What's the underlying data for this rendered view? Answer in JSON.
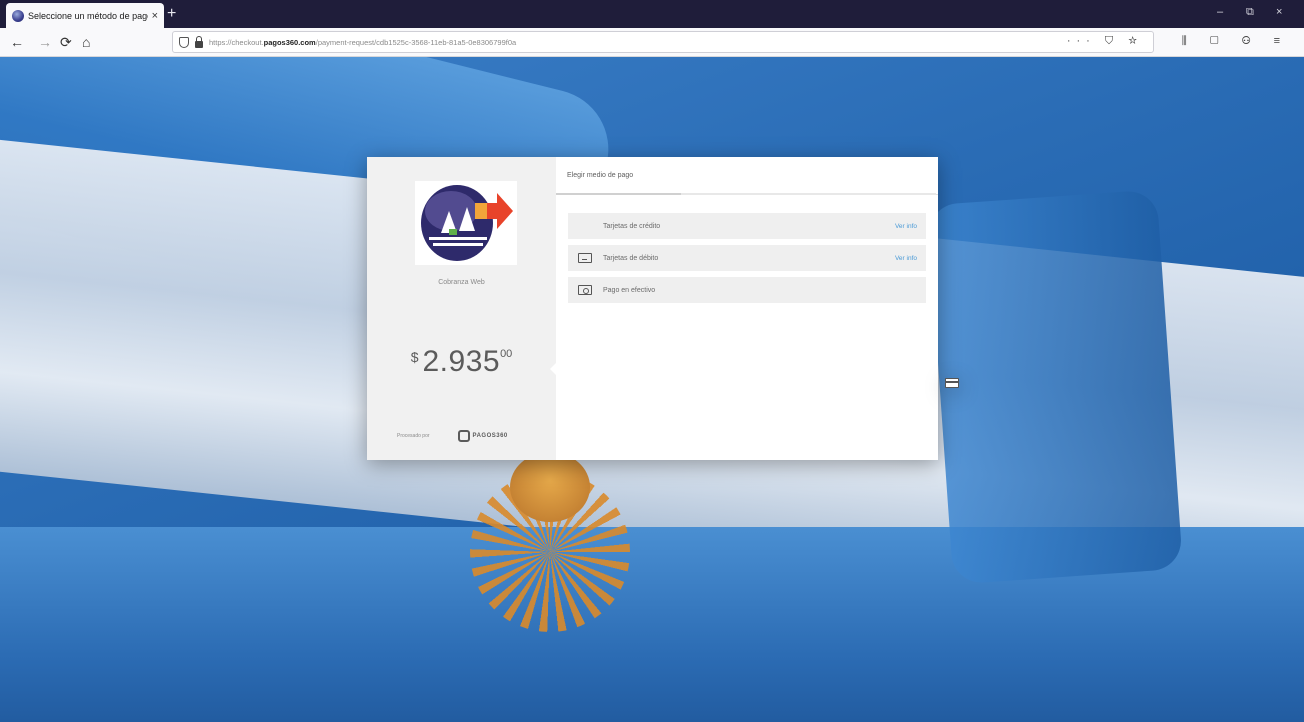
{
  "browser": {
    "tab_title": "Seleccione un método de pago",
    "tab_close": "×",
    "new_tab": "+",
    "url_prefix": "https://checkout.",
    "url_domain": "pagos360.com",
    "url_path": "/payment-request/cdb1525c-3568-11eb-81a5-0e8306799f0a",
    "window_controls": {
      "minimize": "–",
      "maximize": "⧉",
      "close": "×"
    },
    "nav": {
      "back": "←",
      "forward": "→",
      "reload": "⟳",
      "home": "⌂"
    },
    "url_actions": "··· ⛉ ☆",
    "toolbar_icons": "⫼ ▢ ⚇ ≡"
  },
  "payment": {
    "merchant_name": "Cobranza Web",
    "currency_symbol": "$",
    "amount_integer": "2.935",
    "amount_cents": "00",
    "powered_by": "Procesado por",
    "processor_name": "PAGOS360",
    "tab_label": "Elegir medio de pago",
    "methods": [
      {
        "label": "Tarjetas de crédito",
        "info": "Ver info",
        "icon": "credit-card-icon"
      },
      {
        "label": "Tarjetas de débito",
        "info": "Ver info",
        "icon": "debit-card-icon"
      },
      {
        "label": "Pago en efectivo",
        "info": "",
        "icon": "cash-icon"
      }
    ]
  },
  "colors": {
    "link": "#4a9ad6",
    "panel_left": "#f1f1f1",
    "chrome_dark": "#1f1d3a"
  }
}
